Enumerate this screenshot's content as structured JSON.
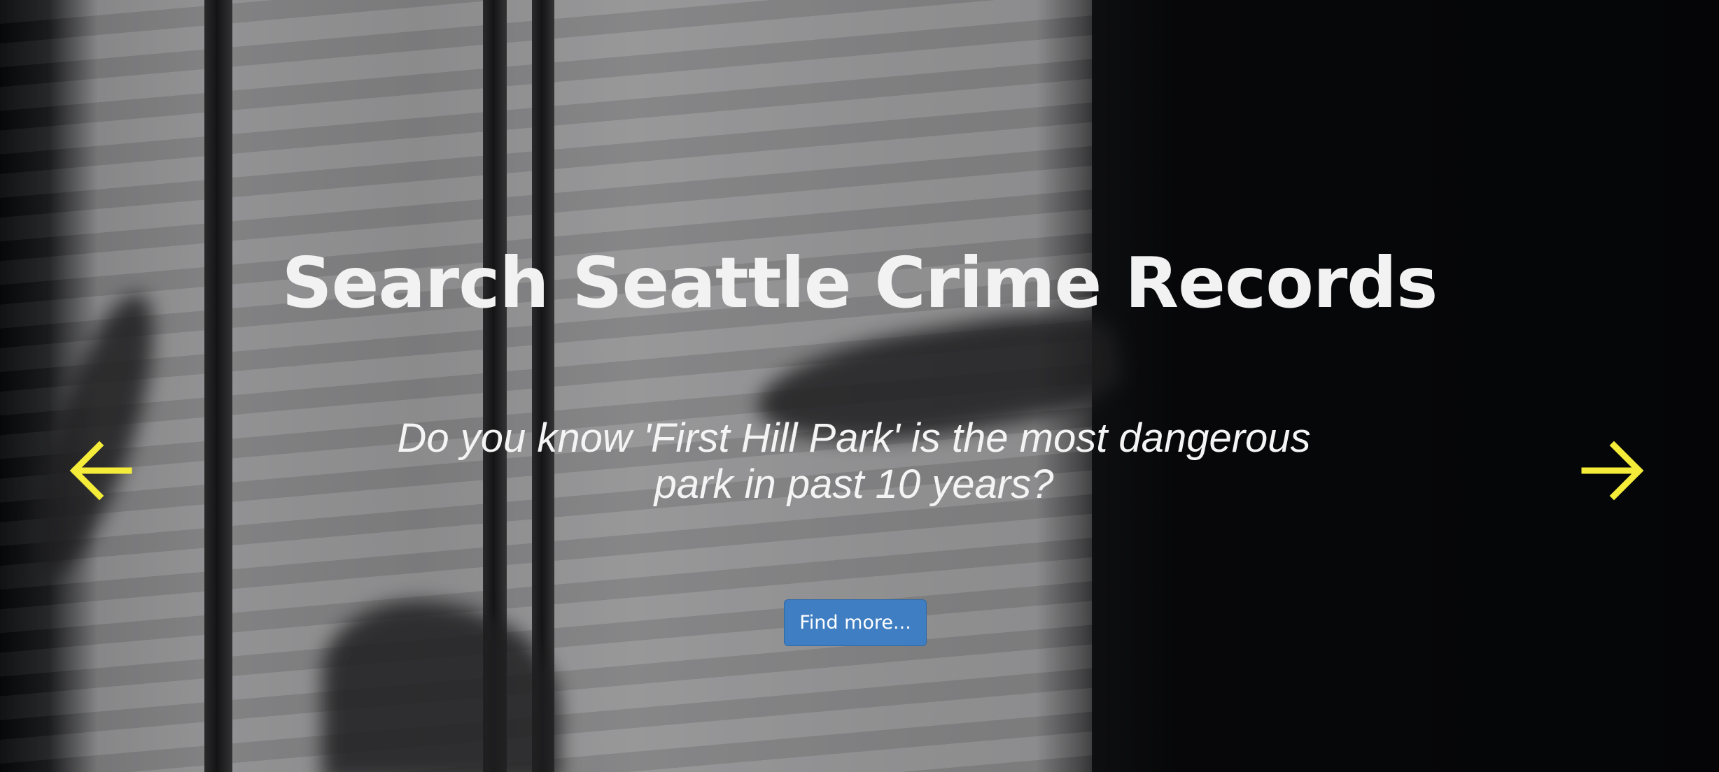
{
  "hero": {
    "title": "Search Seattle Crime Records",
    "subtitle": "Do you know 'First Hill Park' is the most dangerous park in past 10 years?",
    "cta_label": "Find more...",
    "prev_icon": "arrow-left-icon",
    "next_icon": "arrow-right-icon"
  },
  "colors": {
    "arrow": "#f5ec3a",
    "button": "#3f7ec2",
    "title_text": "#f2f2f2"
  }
}
